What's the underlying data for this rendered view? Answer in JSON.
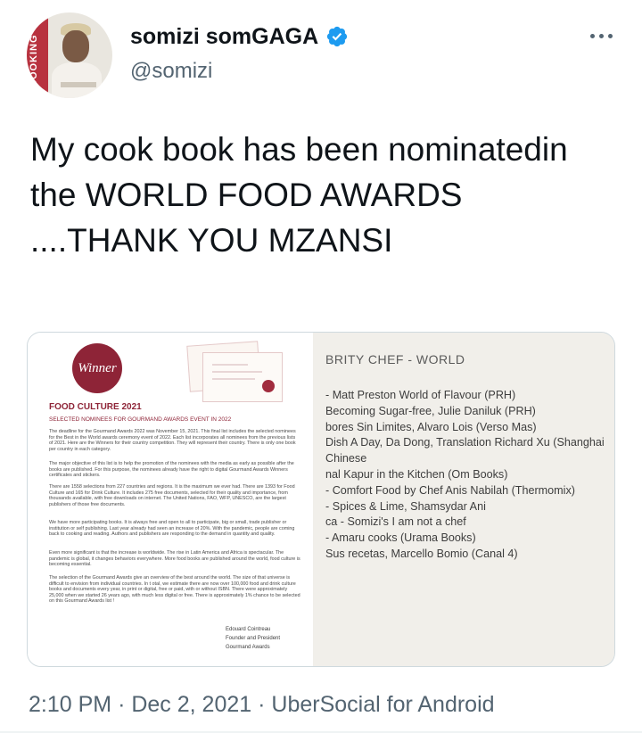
{
  "author": {
    "display_name": "somizi somGAGA",
    "handle": "@somizi",
    "verified": true,
    "avatar_band_text": "BOOKING"
  },
  "tweet": {
    "text": "My cook book has been nominatedin the WORLD FOOD AWARDS ....THANK YOU MZANSI"
  },
  "image": {
    "left_page": {
      "badge": "Winner",
      "title": "FOOD CULTURE 2021",
      "subtitle": "SELECTED NOMINEES FOR GOURMAND AWARDS EVENT IN 2022",
      "paragraphs": [
        "The deadline for the Gourmand Awards 2022 was November 15, 2021. This final list includes the selected nominees for the Best in the World awards ceremony event of 2022. Each list incorporates all nominees from the previous lists of 2021. Here are the Winners for their country competition. They will represent their country. There is only one book per country in each category.",
        "The major objective of this list is to help the promotion of the nominees with the media as early as possible after the books are published. For this purpose, the nominees already have the right to digital Gourmand Awards Winners certificates and stickers.",
        "There are 1558 selections from 227 countries and regions. It is the maximum we ever had. There are 1393 for Food Culture and 165 for Drink Culture. It includes 275 free documents, selected for their quality and importance, from thousands available, with free downloads on internet. The United Nations, FAO, WFP, UNESCO, are the largest publishers of those free documents.",
        "We have more participating books. It is always free and open to all to participate, big or small, trade publisher or institution or self publishing. Last year already had seen an increase of 20%. With the pandemic, people are coming back to cooking and reading. Authors and publishers are responding to the demand in quantity and quality.",
        "Even more significant is that the increase is worldwide. The rise in Latin America and Africa is spectacular. The pandemic is global, it changes behaviors everywhere. More food books are published around the world, food culture is becoming essential.",
        "The selection of the Gourmand Awards give an overview of the best around the world. The size of that universe is difficult to envision from individual countries. In t otal, we estimate there are now over 100,000 food and drink culture books and documents every year, in print or digital, free or paid, with or without ISBN. There were approximately 25,000 when we started 26 years ago, with much less digital or free. There is approximately 1% chance to be selected on this Gourmand Awards list !"
      ],
      "signature_name": "Edouard Cointreau",
      "signature_title": "Founder and President",
      "signature_org": "Gourmand Awards"
    },
    "right_page": {
      "heading": "BRITY CHEF - WORLD",
      "entries": [
        "- Matt Preston World of Flavour (PRH)",
        "Becoming Sugar-free, Julie Daniluk (PRH)",
        "bores Sin Limites, Alvaro Lois (Verso Mas)",
        "Dish A Day, Da Dong, Translation Richard Xu (Shanghai",
        "Chinese",
        "nal Kapur in the Kitchen (Om Books)",
        "- Comfort Food by Chef Anis Nabilah (Thermomix)",
        "- Spices & Lime, Shamsydar Ani",
        "ca - Somizi's I am not a chef",
        "- Amaru cooks (Urama Books)",
        "Sus recetas, Marcello Bomio (Canal 4)"
      ]
    }
  },
  "meta": {
    "time": "2:10 PM",
    "separator": "·",
    "date": "Dec 2, 2021",
    "source": "UberSocial for Android"
  },
  "colors": {
    "text_primary": "#0f1419",
    "text_secondary": "#536471",
    "verified": "#1d9bf0",
    "gourmand_red": "#8e2437"
  }
}
